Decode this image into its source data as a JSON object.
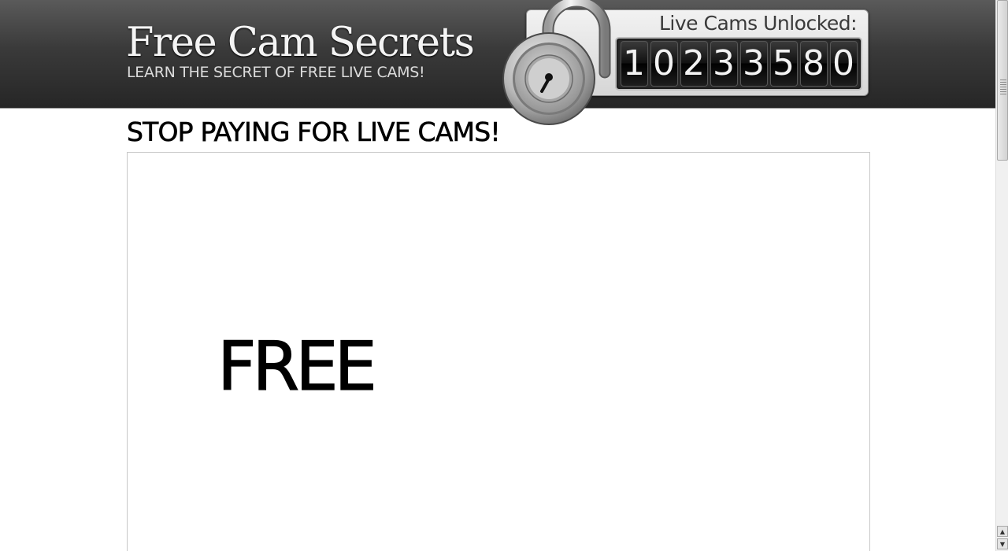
{
  "header": {
    "title": "Free Cam Secrets",
    "tagline": "LEARN THE SECRET OF FREE LIVE CAMS!"
  },
  "counter": {
    "label": "Live Cams Unlocked:",
    "digits": [
      "1",
      "0",
      "2",
      "3",
      "3",
      "5",
      "8",
      "0"
    ]
  },
  "main": {
    "headline": "STOP PAYING FOR LIVE CAMS!",
    "free_text": "FREE"
  },
  "icons": {
    "lock": "padlock-icon",
    "scroll_up": "scroll-up-arrow-icon",
    "scroll_down": "scroll-down-arrow-icon"
  },
  "colors": {
    "header_bg": "#2e2e2e",
    "header_text": "#f4f4f4",
    "counter_panel": "#e0e0e0",
    "digit_bg": "#111111",
    "text": "#000000"
  }
}
